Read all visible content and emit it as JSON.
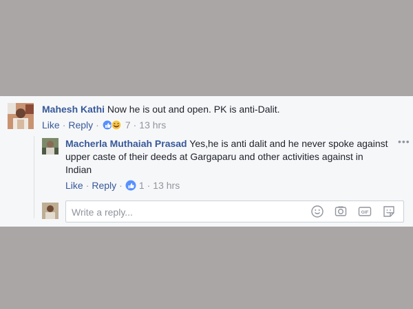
{
  "comment": {
    "author": "Mahesh Kathi",
    "text": "Now he is out and open. PK is anti-Dalit.",
    "like_label": "Like",
    "reply_label": "Reply",
    "reaction_count": "7",
    "time": "13 hrs"
  },
  "reply": {
    "author": "Macherla Muthaiah Prasad",
    "text": "Yes,he is anti dalit and he never spoke against upper caste of their deeds at Gargaparu and other activities against in Indian",
    "like_label": "Like",
    "reply_label": "Reply",
    "reaction_count": "1",
    "time": "13 hrs"
  },
  "reply_box": {
    "placeholder": "Write a reply...",
    "tools": [
      "emoji-icon",
      "camera-icon",
      "gif-icon",
      "sticker-icon"
    ]
  },
  "colors": {
    "link": "#365899",
    "meta": "#90949c",
    "like_blue": "#5890ff",
    "haha_yellow": "#f7c94a"
  }
}
